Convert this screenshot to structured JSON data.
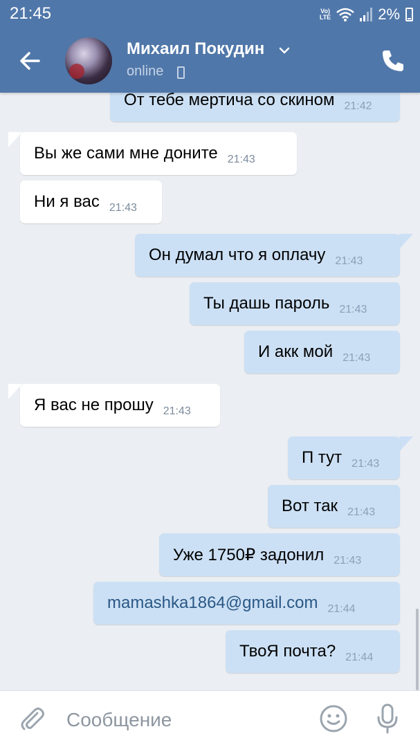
{
  "status_bar": {
    "time": "21:45",
    "network_label": "Vo) LTE",
    "battery": "2%"
  },
  "header": {
    "contact_name": "Михаил Покудин",
    "status": "online"
  },
  "messages": [
    {
      "dir": "out",
      "text": "От тебе мертича со скином",
      "time": "21:42"
    },
    {
      "dir": "in",
      "text": "Вы же сами мне доните",
      "time": "21:43"
    },
    {
      "dir": "in",
      "text": "Ни я вас",
      "time": "21:43"
    },
    {
      "dir": "out",
      "text": "Он думал что я оплачу",
      "time": "21:43"
    },
    {
      "dir": "out",
      "text": "Ты дашь пароль",
      "time": "21:43"
    },
    {
      "dir": "out",
      "text": "И акк мой",
      "time": "21:43"
    },
    {
      "dir": "in",
      "text": "Я вас не прошу",
      "time": "21:43"
    },
    {
      "dir": "out",
      "text": "П тут",
      "time": "21:43"
    },
    {
      "dir": "out",
      "text": "Вот так",
      "time": "21:43"
    },
    {
      "dir": "out",
      "text": "Уже 1750₽ задонил",
      "time": "21:43"
    },
    {
      "dir": "out",
      "text": "mamashka1864@gmail.com",
      "time": "21:44",
      "link": true
    },
    {
      "dir": "out",
      "text": "ТвоЯ почта?",
      "time": "21:44"
    }
  ],
  "composer": {
    "placeholder": "Сообщение"
  },
  "colors": {
    "header": "#5077a9",
    "chat_bg": "#ebeef2",
    "incoming": "#ffffff",
    "outgoing": "#cce0f5",
    "link": "#2a5885"
  },
  "icons": [
    "back-arrow-icon",
    "chevron-down-icon",
    "phone-icon",
    "mobile-device-icon",
    "paperclip-icon",
    "smile-icon",
    "microphone-icon",
    "wifi-icon",
    "signal-icon",
    "battery-icon"
  ]
}
